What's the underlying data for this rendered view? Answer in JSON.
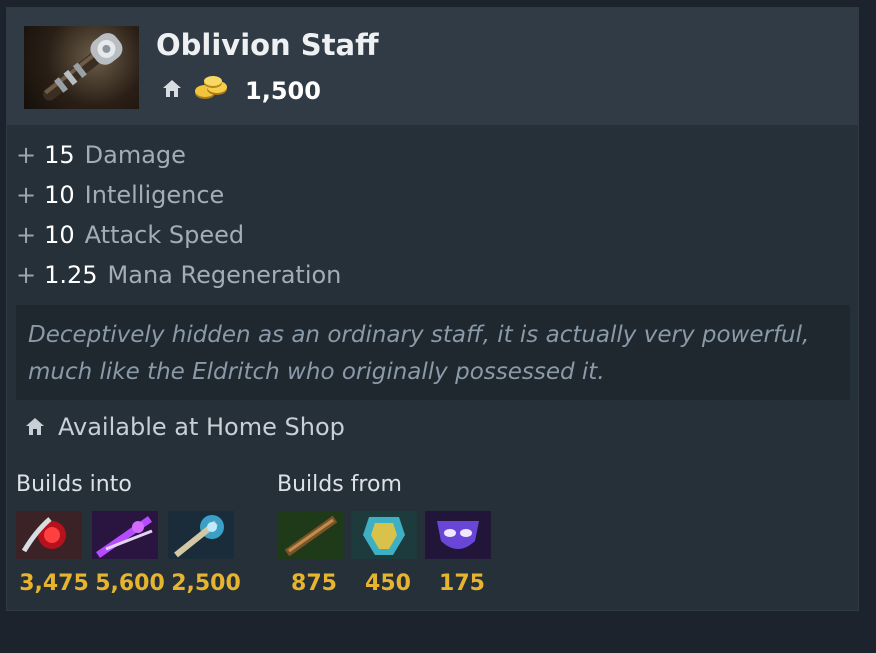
{
  "item": {
    "name": "Oblivion Staff",
    "cost": "1,500"
  },
  "stats": [
    {
      "value": "15",
      "name": "Damage"
    },
    {
      "value": "10",
      "name": "Intelligence"
    },
    {
      "value": "10",
      "name": "Attack Speed"
    },
    {
      "value": "1.25",
      "name": "Mana Regeneration"
    }
  ],
  "lore": "Deceptively hidden as an ordinary staff, it is actually very powerful, much like the Eldritch who originally possessed it.",
  "shop": {
    "label": "Available at Home Shop"
  },
  "builds_into": {
    "label": "Builds into",
    "items": [
      {
        "price": "3,475"
      },
      {
        "price": "5,600"
      },
      {
        "price": "2,500"
      }
    ]
  },
  "builds_from": {
    "label": "Builds from",
    "items": [
      {
        "price": "875"
      },
      {
        "price": "450"
      },
      {
        "price": "175"
      }
    ]
  },
  "colors": {
    "gold": "#e7b42f",
    "panel": "#263039",
    "header": "#303b46"
  }
}
